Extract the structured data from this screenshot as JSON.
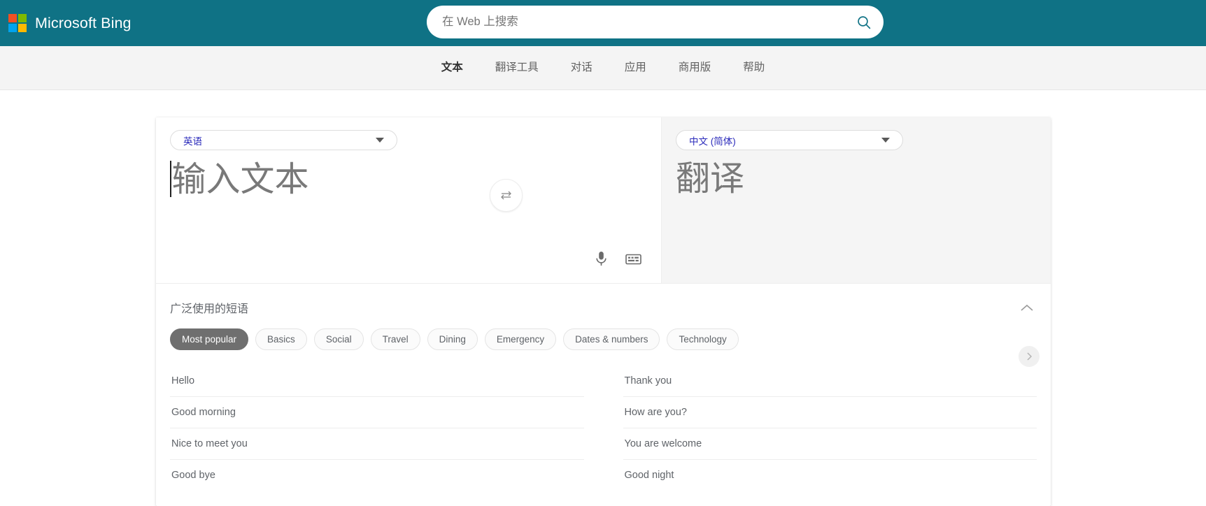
{
  "header": {
    "brand_name": "Microsoft Bing",
    "logo_colors": {
      "top_left": "#f25022",
      "top_right": "#7fba00",
      "bottom_left": "#00a4ef",
      "bottom_right": "#ffb900"
    },
    "background_color": "#0f7285",
    "search": {
      "placeholder": "在 Web 上搜索",
      "value": "",
      "icon": "search-icon",
      "icon_color": "#0f7285"
    }
  },
  "nav": {
    "items": [
      {
        "label": "文本",
        "active": true
      },
      {
        "label": "翻译工具",
        "active": false
      },
      {
        "label": "对话",
        "active": false
      },
      {
        "label": "应用",
        "active": false
      },
      {
        "label": "商用版",
        "active": false
      },
      {
        "label": "帮助",
        "active": false
      }
    ]
  },
  "translator": {
    "source": {
      "language": "英语",
      "placeholder": "输入文本",
      "value": "",
      "caret_visible": true,
      "tools": [
        {
          "icon": "microphone-icon",
          "name": "voice-input-button"
        },
        {
          "icon": "keyboard-icon",
          "name": "keyboard-input-button"
        }
      ]
    },
    "target": {
      "language": "中文 (简体)",
      "placeholder": "翻译",
      "value": ""
    },
    "swap_button": {
      "icon": "swap-arrows-icon",
      "label": ""
    }
  },
  "phrases": {
    "title": "广泛使用的短语",
    "collapse_icon": "chevron-up-icon",
    "next_icon": "chevron-right-icon",
    "categories": [
      {
        "label": "Most popular",
        "active": true
      },
      {
        "label": "Basics",
        "active": false
      },
      {
        "label": "Social",
        "active": false
      },
      {
        "label": "Travel",
        "active": false
      },
      {
        "label": "Dining",
        "active": false
      },
      {
        "label": "Emergency",
        "active": false
      },
      {
        "label": "Dates & numbers",
        "active": false
      },
      {
        "label": "Technology",
        "active": false
      }
    ],
    "left_column": [
      "Hello",
      "Good morning",
      "Nice to meet you",
      "Good bye"
    ],
    "right_column": [
      "Thank you",
      "How are you?",
      "You are welcome",
      "Good night"
    ]
  }
}
